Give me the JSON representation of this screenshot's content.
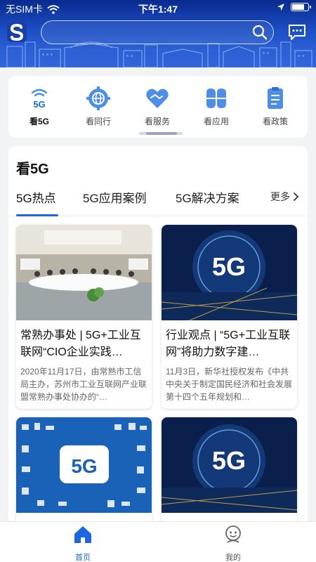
{
  "status_bar": {
    "carrier": "无SIM卡",
    "time": "下午1:47",
    "battery_level": 0.85
  },
  "header": {
    "search": {
      "value": "",
      "placeholder": ""
    }
  },
  "categories": [
    {
      "label": "看5G",
      "icon": "5g-signal-icon",
      "active": true
    },
    {
      "label": "看同行",
      "icon": "gear-globe-icon",
      "active": false
    },
    {
      "label": "看服务",
      "icon": "handshake-icon",
      "active": false
    },
    {
      "label": "看应用",
      "icon": "clover-icon",
      "active": false
    },
    {
      "label": "看政策",
      "icon": "clipboard-icon",
      "active": false
    }
  ],
  "category_icon_text": "5G",
  "section": {
    "title": "看5G",
    "tabs": [
      "5G热点",
      "5G应用案例",
      "5G解决方案"
    ],
    "active_tab": 0,
    "more_label": "更多"
  },
  "news": [
    {
      "title": "常熟办事处 | 5G+工业互联网“CIO企业实践…",
      "summary": "2020年11月17日，由常熟市工信局主办，苏州市工业互联网产业联盟常熟办事处协办的“…",
      "image": "meeting-room"
    },
    {
      "title": "行业观点 | “5G+工业互联网”将助力数字建…",
      "summary": "11月3日，新华社授权发布《中共中央关于制定国民经济和社会发展第十四个五年规划和…",
      "image": "5g-city"
    },
    {
      "title": "",
      "summary": "",
      "image": "5g-icons"
    },
    {
      "title": "",
      "summary": "",
      "image": "5g-city"
    }
  ],
  "thumb_text": "5G",
  "bottom_nav": [
    {
      "label": "首页",
      "icon": "home-icon",
      "active": true
    },
    {
      "label": "我的",
      "icon": "profile-icon",
      "active": false
    }
  ],
  "colors": {
    "accent": "#1d66e0",
    "header_dark": "#0a2a8f",
    "header_light": "#3a6fe0"
  }
}
